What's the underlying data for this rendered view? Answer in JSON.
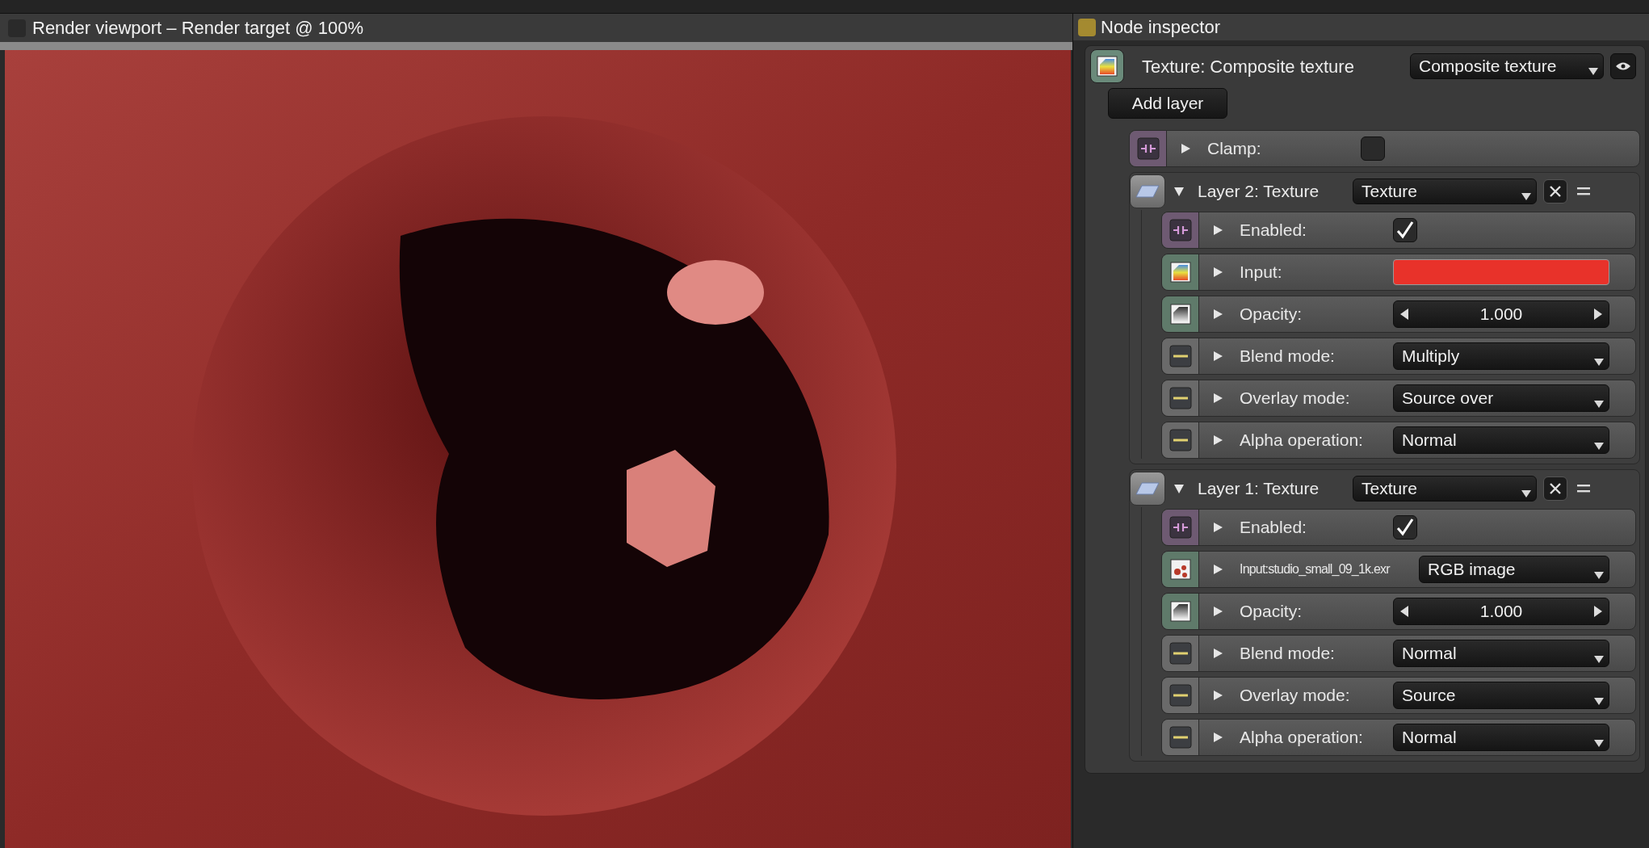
{
  "viewport": {
    "title": "Render viewport – Render target @ 100%"
  },
  "inspector": {
    "title": "Node inspector",
    "node": {
      "label": "Texture: Composite texture",
      "type": "Composite texture"
    },
    "add_button": "Add layer",
    "params": [
      {
        "kind": "checkbox",
        "label": "Clamp:",
        "expanded": false,
        "checked": false
      }
    ],
    "layers": [
      {
        "title": "Layer 2: Texture",
        "type": "Texture",
        "expanded": true,
        "params": [
          {
            "kind": "checkbox",
            "label": "Enabled:",
            "expanded": false,
            "checked": true
          },
          {
            "kind": "color",
            "label": "Input:",
            "expanded": false,
            "color": "#e8322a"
          },
          {
            "kind": "number",
            "label": "Opacity:",
            "expanded": false,
            "value": "1.000"
          },
          {
            "kind": "dropdown",
            "label": "Blend mode:",
            "expanded": false,
            "value": "Multiply"
          },
          {
            "kind": "dropdown",
            "label": "Overlay mode:",
            "expanded": false,
            "value": "Source over"
          },
          {
            "kind": "dropdown",
            "label": "Alpha operation:",
            "expanded": false,
            "value": "Normal"
          }
        ]
      },
      {
        "title": "Layer 1: Texture",
        "type": "Texture",
        "expanded": true,
        "params": [
          {
            "kind": "checkbox",
            "label": "Enabled:",
            "expanded": false,
            "checked": true
          },
          {
            "kind": "image",
            "label": "Input:studio_small_09_1k.exr",
            "expanded": false,
            "value": "RGB image"
          },
          {
            "kind": "number",
            "label": "Opacity:",
            "expanded": false,
            "value": "1.000"
          },
          {
            "kind": "dropdown",
            "label": "Blend mode:",
            "expanded": false,
            "value": "Normal"
          },
          {
            "kind": "dropdown",
            "label": "Overlay mode:",
            "expanded": false,
            "value": "Source"
          },
          {
            "kind": "dropdown",
            "label": "Alpha operation:",
            "expanded": false,
            "value": "Normal"
          }
        ]
      }
    ]
  }
}
